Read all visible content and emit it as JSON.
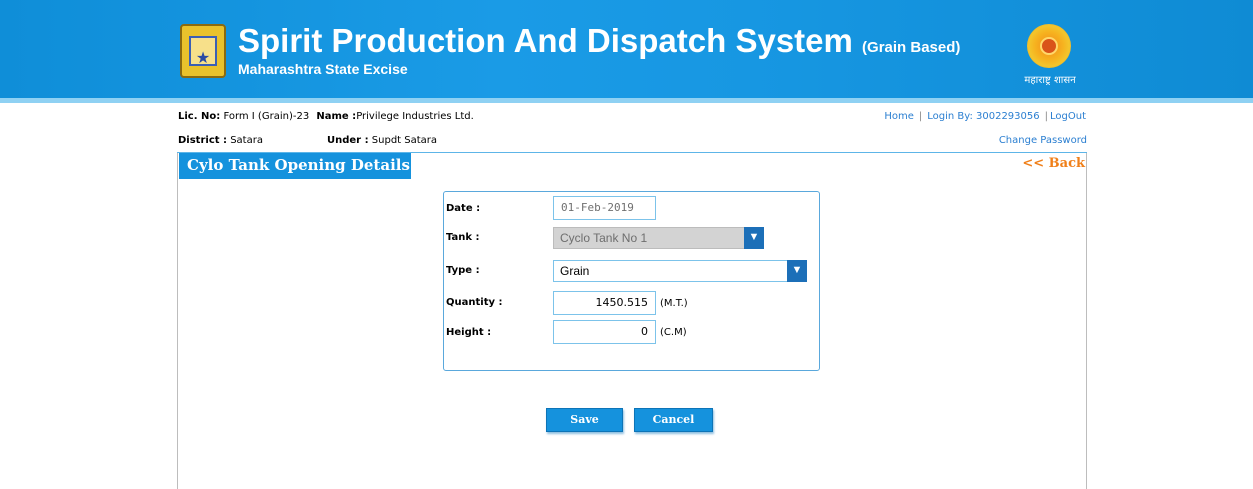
{
  "header": {
    "title": "Spirit Production And Dispatch System",
    "title_suffix": "(Grain Based)",
    "subtitle": "Maharashtra State Excise",
    "emblem_caption": "महाराष्ट्र शासन"
  },
  "license": {
    "lic_label": "Lic. No:",
    "lic_value": "Form I (Grain)-23",
    "name_label": "Name :",
    "name_value": "Privilege Industries Ltd.",
    "district_label": "District :",
    "district_value": "Satara",
    "under_label": "Under :",
    "under_value": "Supdt Satara"
  },
  "toplinks": {
    "home": "Home",
    "sep1": "|",
    "login_by": "Login By: 3002293056",
    "sep2": "|",
    "logout": "LogOut",
    "change_password": "Change Password"
  },
  "page": {
    "title": "Cylo Tank Opening Details",
    "back": "<< Back"
  },
  "form": {
    "date_label": "Date :",
    "date_value": "01-Feb-2019",
    "tank_label": "Tank :",
    "tank_value": "Cyclo Tank No 1",
    "type_label": "Type :",
    "type_value": "Grain",
    "quantity_label": "Quantity :",
    "quantity_value": "1450.515",
    "quantity_unit": "(M.T.)",
    "height_label": "Height :",
    "height_value": "0",
    "height_unit": "(C.M)"
  },
  "buttons": {
    "save": "Save",
    "cancel": "Cancel"
  },
  "colors": {
    "header_blue": "#1797e2",
    "accent_blue": "#1592dd",
    "link_blue": "#2b7fd1",
    "back_orange": "#f07f18"
  }
}
